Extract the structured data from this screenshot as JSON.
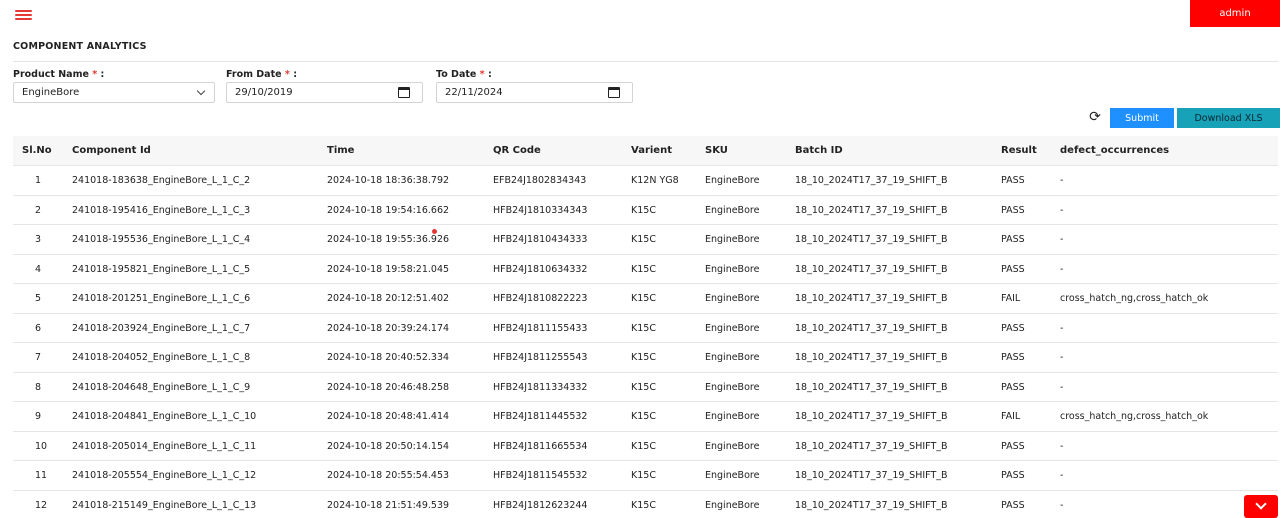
{
  "header": {
    "user_label": "admin"
  },
  "page_title": "COMPONENT ANALYTICS",
  "filters": {
    "product": {
      "label": "Product Name",
      "required": "*",
      "colon": ":",
      "value": "EngineBore"
    },
    "from_date": {
      "label": "From Date",
      "required": "*",
      "colon": ":",
      "value": "29/10/2019"
    },
    "to_date": {
      "label": "To Date",
      "required": "*",
      "colon": ":",
      "value": "22/11/2024"
    }
  },
  "actions": {
    "submit_label": "Submit",
    "download_label": "Download XLS"
  },
  "colors": {
    "accent_red": "#ff0000",
    "submit_blue": "#1e90ff",
    "download_teal": "#17a2b8"
  },
  "table": {
    "columns": [
      "Sl.No",
      "Component Id",
      "Time",
      "QR Code",
      "Varient",
      "SKU",
      "Batch ID",
      "Result",
      "defect_occurrences"
    ],
    "rows": [
      [
        "1",
        "241018-183638_EngineBore_L_1_C_2",
        "2024-10-18 18:36:38.792",
        "EFB24J1802834343",
        "K12N YG8",
        "EngineBore",
        "18_10_2024T17_37_19_SHIFT_B",
        "PASS",
        "-"
      ],
      [
        "2",
        "241018-195416_EngineBore_L_1_C_3",
        "2024-10-18 19:54:16.662",
        "HFB24J1810334343",
        "K15C",
        "EngineBore",
        "18_10_2024T17_37_19_SHIFT_B",
        "PASS",
        "-"
      ],
      [
        "3",
        "241018-195536_EngineBore_L_1_C_4",
        "2024-10-18 19:55:36.926",
        "HFB24J1810434333",
        "K15C",
        "EngineBore",
        "18_10_2024T17_37_19_SHIFT_B",
        "PASS",
        "-"
      ],
      [
        "4",
        "241018-195821_EngineBore_L_1_C_5",
        "2024-10-18 19:58:21.045",
        "HFB24J1810634332",
        "K15C",
        "EngineBore",
        "18_10_2024T17_37_19_SHIFT_B",
        "PASS",
        "-"
      ],
      [
        "5",
        "241018-201251_EngineBore_L_1_C_6",
        "2024-10-18 20:12:51.402",
        "HFB24J1810822223",
        "K15C",
        "EngineBore",
        "18_10_2024T17_37_19_SHIFT_B",
        "FAIL",
        "cross_hatch_ng,cross_hatch_ok"
      ],
      [
        "6",
        "241018-203924_EngineBore_L_1_C_7",
        "2024-10-18 20:39:24.174",
        "HFB24J1811155433",
        "K15C",
        "EngineBore",
        "18_10_2024T17_37_19_SHIFT_B",
        "PASS",
        "-"
      ],
      [
        "7",
        "241018-204052_EngineBore_L_1_C_8",
        "2024-10-18 20:40:52.334",
        "HFB24J1811255543",
        "K15C",
        "EngineBore",
        "18_10_2024T17_37_19_SHIFT_B",
        "PASS",
        "-"
      ],
      [
        "8",
        "241018-204648_EngineBore_L_1_C_9",
        "2024-10-18 20:46:48.258",
        "HFB24J1811334332",
        "K15C",
        "EngineBore",
        "18_10_2024T17_37_19_SHIFT_B",
        "PASS",
        "-"
      ],
      [
        "9",
        "241018-204841_EngineBore_L_1_C_10",
        "2024-10-18 20:48:41.414",
        "HFB24J1811445532",
        "K15C",
        "EngineBore",
        "18_10_2024T17_37_19_SHIFT_B",
        "FAIL",
        "cross_hatch_ng,cross_hatch_ok"
      ],
      [
        "10",
        "241018-205014_EngineBore_L_1_C_11",
        "2024-10-18 20:50:14.154",
        "HFB24J1811665534",
        "K15C",
        "EngineBore",
        "18_10_2024T17_37_19_SHIFT_B",
        "PASS",
        "-"
      ],
      [
        "11",
        "241018-205554_EngineBore_L_1_C_12",
        "2024-10-18 20:55:54.453",
        "HFB24J1811545532",
        "K15C",
        "EngineBore",
        "18_10_2024T17_37_19_SHIFT_B",
        "PASS",
        "-"
      ],
      [
        "12",
        "241018-215149_EngineBore_L_1_C_13",
        "2024-10-18 21:51:49.539",
        "HFB24J1812623244",
        "K15C",
        "EngineBore",
        "18_10_2024T17_37_19_SHIFT_B",
        "PASS",
        "-"
      ]
    ]
  }
}
